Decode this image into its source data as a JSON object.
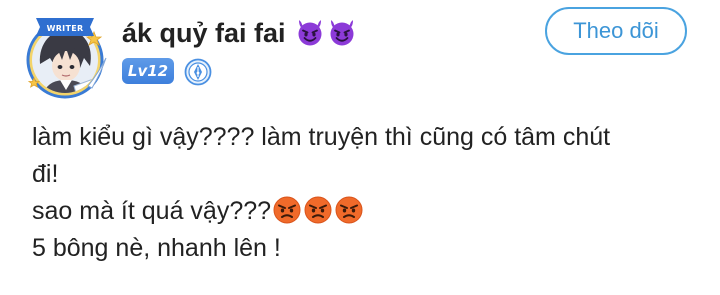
{
  "post": {
    "author": {
      "name": "ák quỷ fai fai",
      "name_emojis": [
        "smiling-devil-emoji",
        "smiling-devil-emoji"
      ],
      "avatar_badge": "WRITER",
      "level": "Lv12"
    },
    "follow_label": "Theo dõi",
    "lines": [
      "làm kiểu gì vậy???? làm truyện thì cũng có tâm chút",
      "đi!",
      "sao mà ít quá vậy???",
      "5 bông nè, nhanh lên !"
    ],
    "line3_emojis": [
      "angry-face-emoji",
      "angry-face-emoji",
      "angry-face-emoji"
    ]
  },
  "colors": {
    "accent": "#4aa3e0",
    "level_badge": "#4a8be0",
    "devil": "#8c3ad8",
    "angry": "#f06a2a"
  }
}
